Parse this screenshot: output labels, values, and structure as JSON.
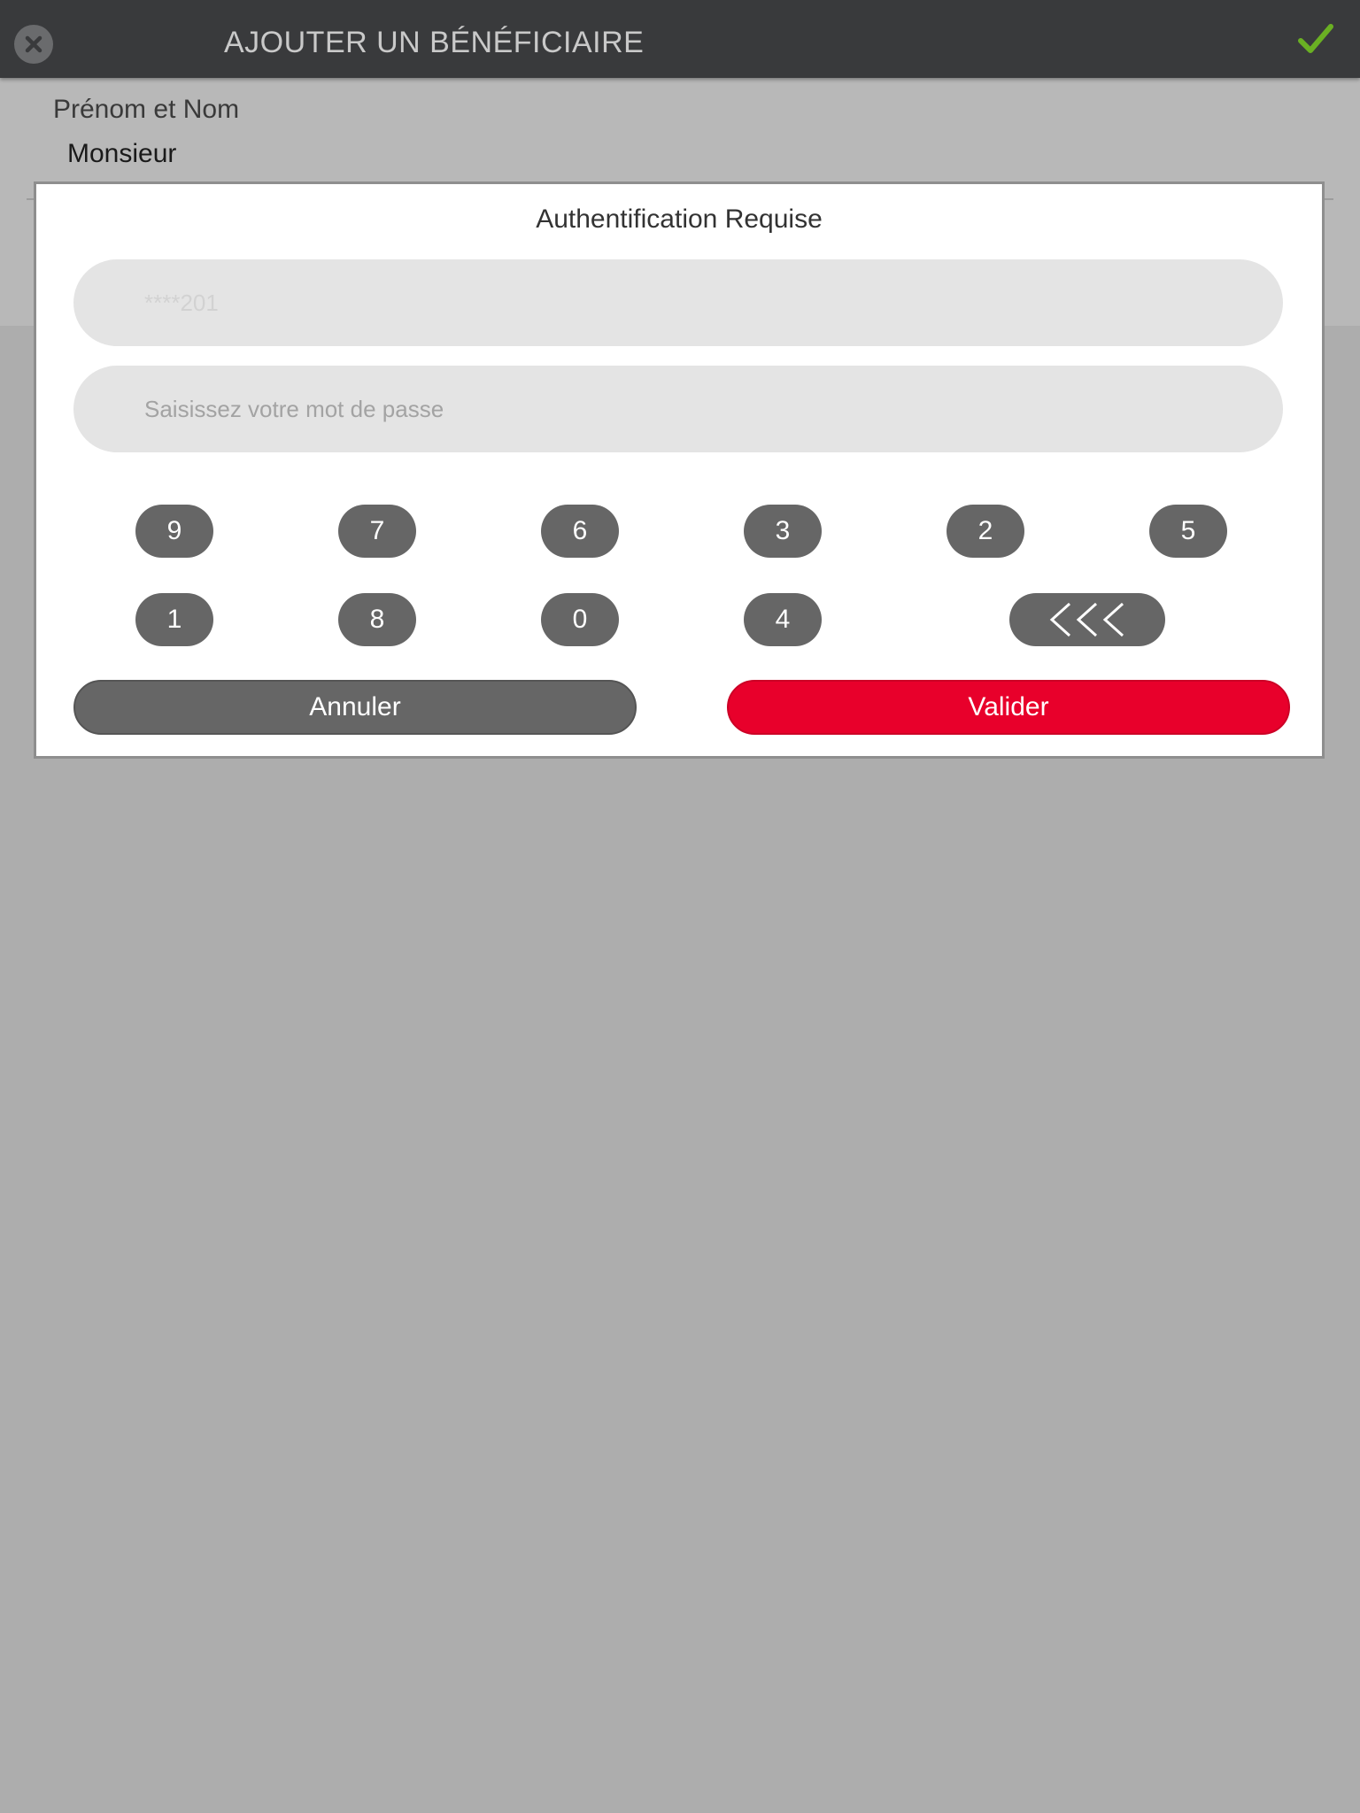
{
  "topbar": {
    "title": "AJOUTER UN BÉNÉFICIAIRE",
    "close_icon": "close-circle-icon",
    "confirm_icon": "checkmark-icon",
    "confirm_color": "#6ab023"
  },
  "form": {
    "label": "Prénom et Nom",
    "value": "Monsieur"
  },
  "modal": {
    "title": "Authentification Requise",
    "identifier_value": "****201",
    "password_placeholder": "Saisissez votre mot de passe",
    "keypad": {
      "row1": [
        "9",
        "7",
        "6",
        "3",
        "2",
        "5"
      ],
      "row2": [
        "1",
        "8",
        "0",
        "4"
      ],
      "backspace_icon": "backspace-chevrons-icon"
    },
    "cancel_label": "Annuler",
    "validate_label": "Valider",
    "validate_color": "#e8002b"
  }
}
